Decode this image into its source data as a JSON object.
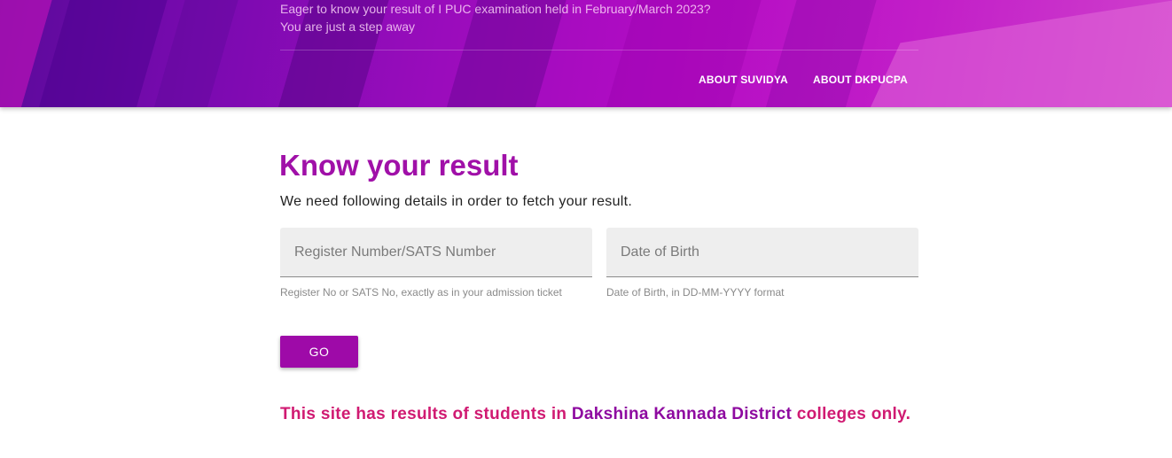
{
  "header": {
    "intro_line1": "Eager to know your result of I PUC examination held in February/March 2023?",
    "intro_line2": "You are just a step away",
    "nav": {
      "about_suvidya": "ABOUT SUVIDYA",
      "about_dkpucpa": "ABOUT DKPUCPA"
    }
  },
  "main": {
    "title": "Know your result",
    "subtitle": "We need following details in order to fetch your result.",
    "register_field": {
      "placeholder": "Register Number/SATS Number",
      "value": "",
      "help": "Register No or SATS No, exactly as in your admission ticket"
    },
    "dob_field": {
      "placeholder": "Date of Birth",
      "value": "",
      "help": "Date of Birth, in DD-MM-YYYY format"
    },
    "go_label": "GO",
    "notice": {
      "prefix": "This site has results of students in ",
      "district": "Dakshina Kannada District",
      "suffix": " colleges only."
    }
  },
  "colors": {
    "brand": "#a010a8",
    "button": "#9e0aa8",
    "notice": "#d01a72"
  }
}
